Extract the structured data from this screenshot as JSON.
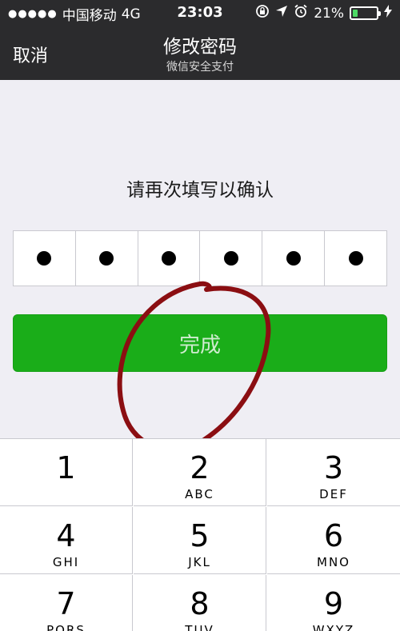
{
  "status_bar": {
    "signal": "●●●●●",
    "carrier": "中国移动",
    "network": "4G",
    "time": "23:03",
    "battery_percent": "21%",
    "battery_level": 0.21,
    "icons": [
      "orientation-lock-icon",
      "location-icon",
      "alarm-icon",
      "charging-icon"
    ]
  },
  "nav": {
    "cancel_label": "取消",
    "title": "修改密码",
    "subtitle": "微信安全支付"
  },
  "prompt": "请再次填写以确认",
  "pin": {
    "length": 6,
    "filled": 6,
    "mask_char": "●"
  },
  "done_button": {
    "label": "完成",
    "color": "#1aad19"
  },
  "annotation": {
    "type": "hand-drawn circle",
    "color": "#8b0e12"
  },
  "keypad": {
    "keys": [
      {
        "num": "1",
        "letters": ""
      },
      {
        "num": "2",
        "letters": "ABC"
      },
      {
        "num": "3",
        "letters": "DEF"
      },
      {
        "num": "4",
        "letters": "GHI"
      },
      {
        "num": "5",
        "letters": "JKL"
      },
      {
        "num": "6",
        "letters": "MNO"
      },
      {
        "num": "7",
        "letters": "PQRS"
      },
      {
        "num": "8",
        "letters": "TUV"
      },
      {
        "num": "9",
        "letters": "WXYZ"
      }
    ]
  }
}
